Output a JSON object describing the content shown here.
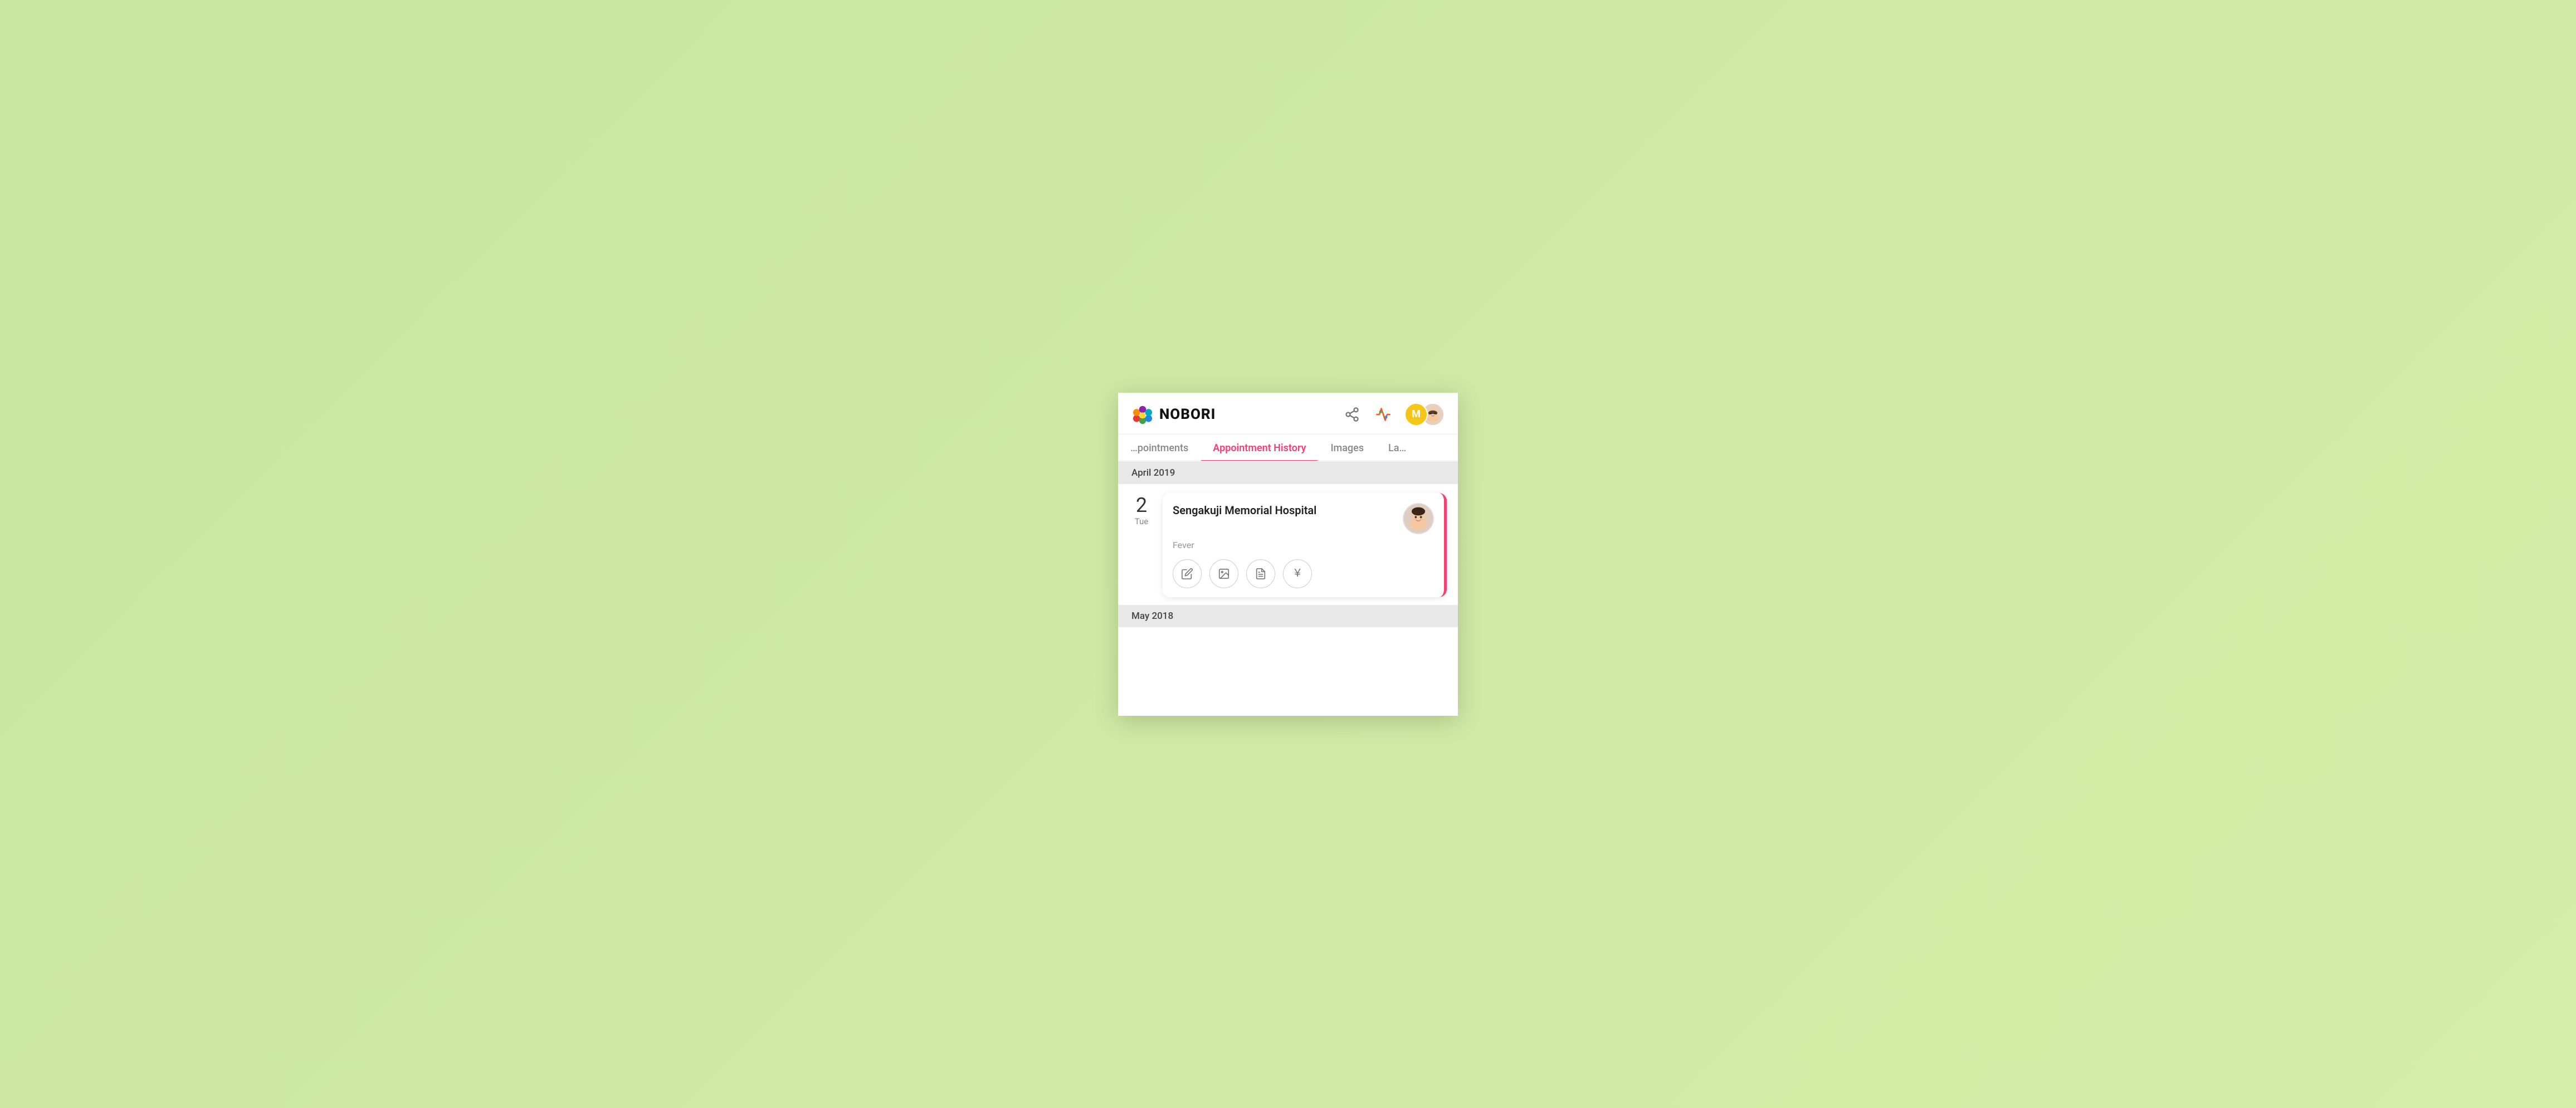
{
  "app": {
    "name": "NOBORI"
  },
  "header": {
    "logo_text": "NOBORI",
    "share_icon": "share-icon",
    "activity_icon": "activity-icon",
    "user_initial": "M"
  },
  "tabs": [
    {
      "id": "appointments",
      "label": "…pointments",
      "active": false
    },
    {
      "id": "appointment-history",
      "label": "Appointment History",
      "active": true
    },
    {
      "id": "images",
      "label": "Images",
      "active": false
    },
    {
      "id": "lab",
      "label": "La…",
      "active": false
    }
  ],
  "sections": [
    {
      "id": "april-2019",
      "label": "April 2019",
      "appointments": [
        {
          "day": "2",
          "weekday": "Tue",
          "hospital": "Sengakuji Memorial Hospital",
          "condition": "Fever",
          "actions": [
            {
              "id": "edit",
              "icon": "edit-icon",
              "symbol": "✏"
            },
            {
              "id": "images",
              "icon": "images-icon",
              "symbol": "🖼"
            },
            {
              "id": "document",
              "icon": "document-icon",
              "symbol": "📋"
            },
            {
              "id": "yen",
              "icon": "yen-icon",
              "symbol": "¥"
            }
          ]
        }
      ]
    },
    {
      "id": "may-2018",
      "label": "May 2018",
      "appointments": []
    }
  ],
  "colors": {
    "accent": "#f43f72",
    "background": "#c8e6a0",
    "section_bg": "#e8e8e8",
    "card_border": "#f43f72"
  }
}
